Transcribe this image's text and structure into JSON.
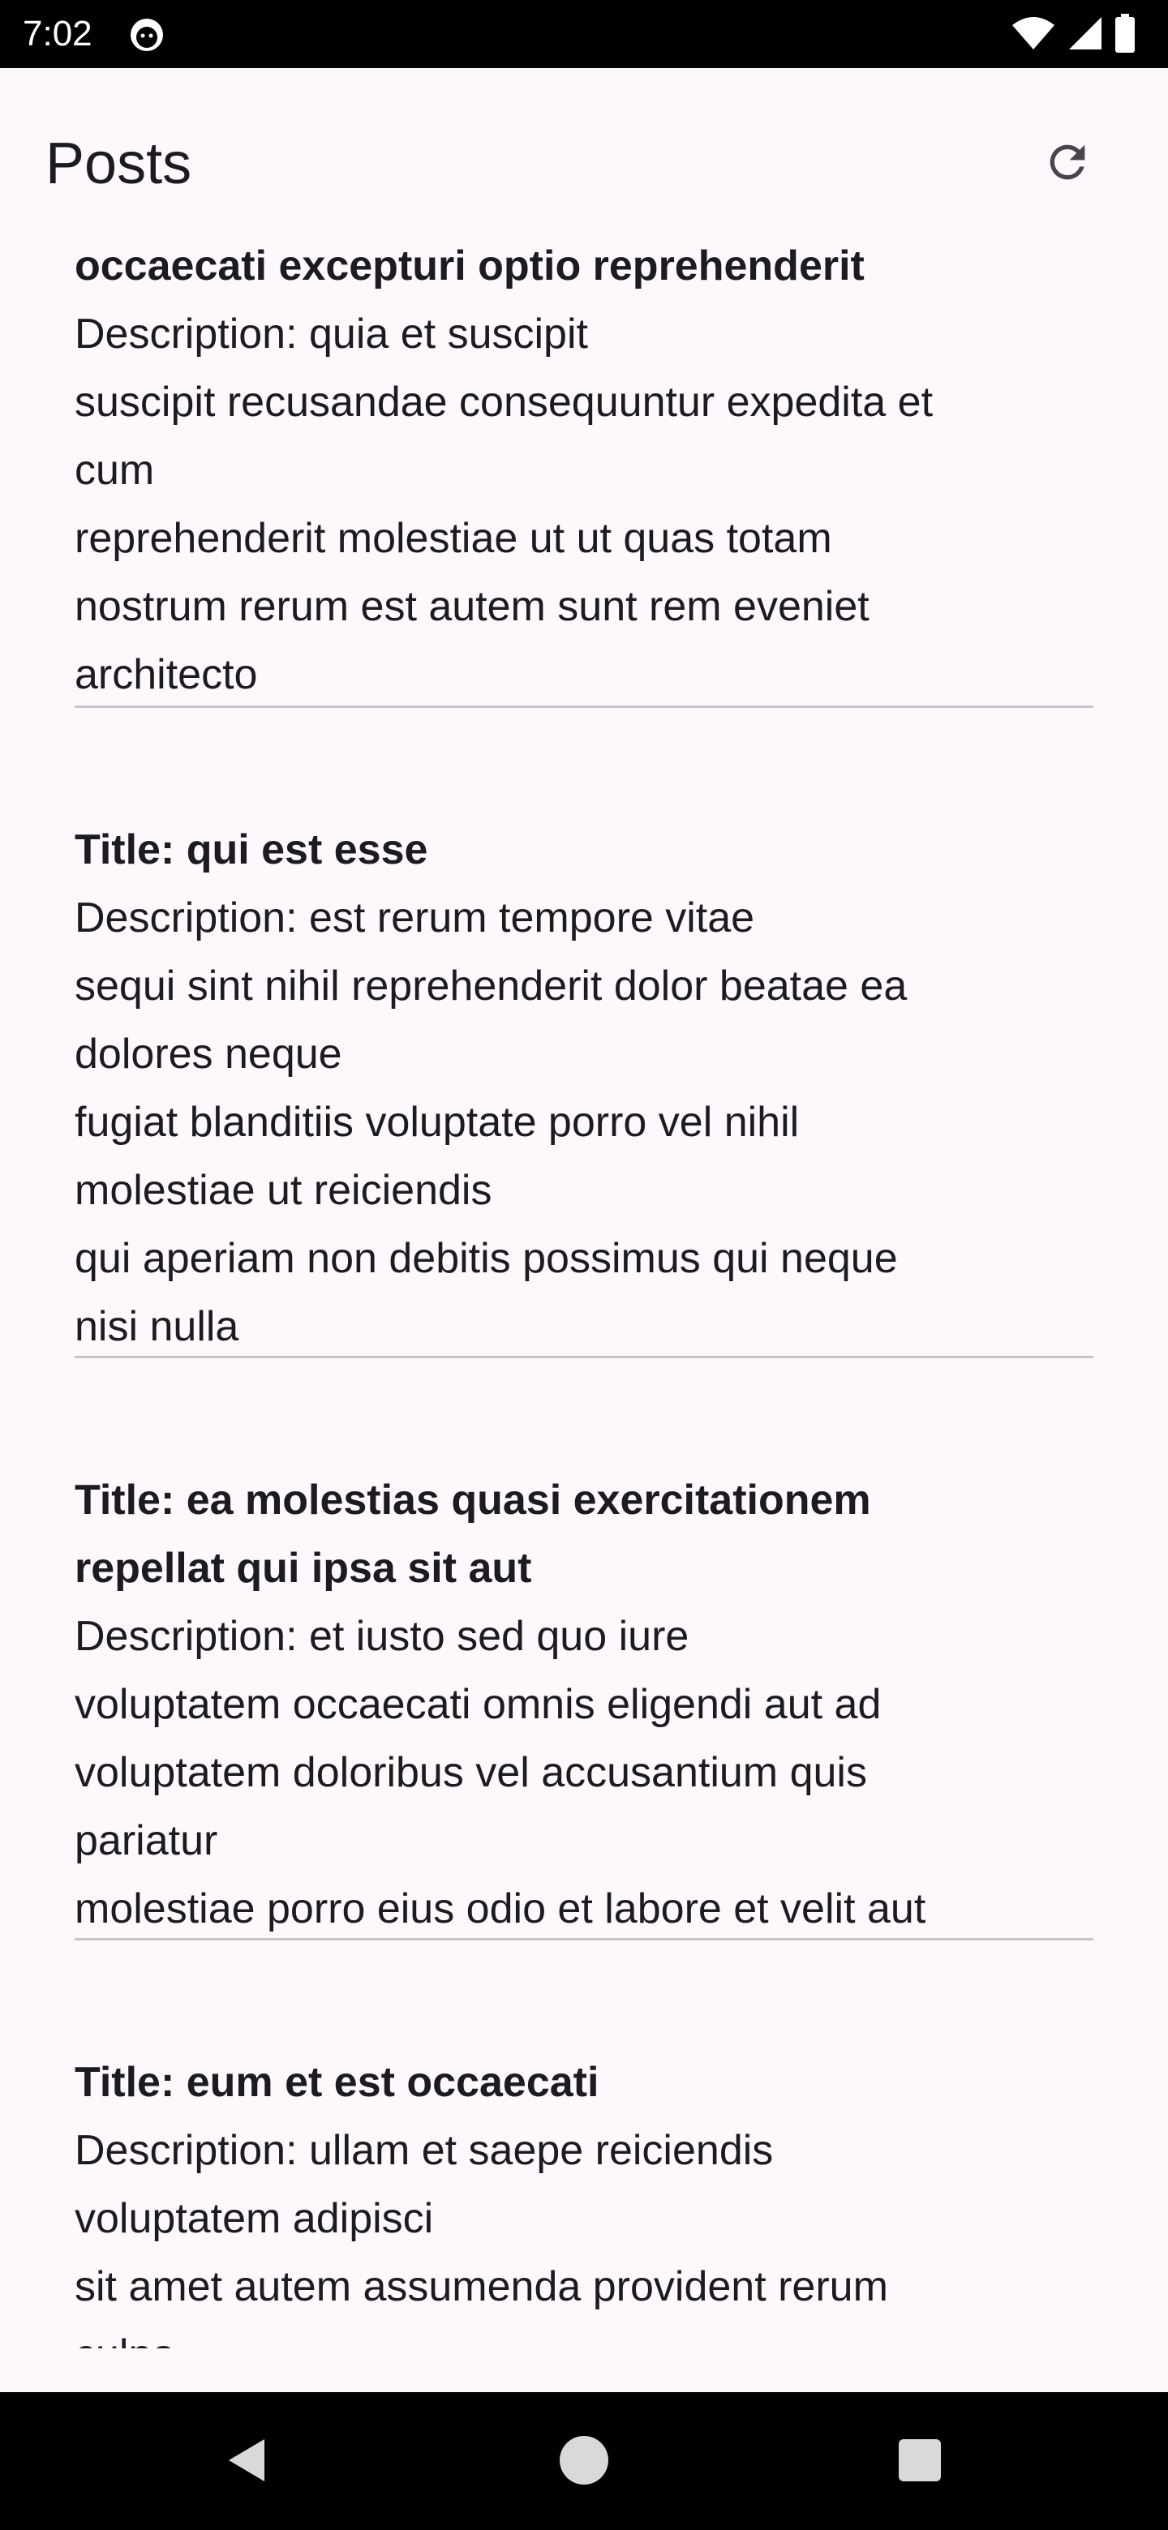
{
  "status_bar": {
    "time": "7:02"
  },
  "app_bar": {
    "title": "Posts",
    "refresh_icon": "refresh-icon"
  },
  "posts": [
    {
      "title": "occaecati excepturi optio reprehenderit",
      "body": "Description: quia et suscipit\nsuscipit recusandae consequuntur expedita et\ncum\nreprehenderit molestiae ut ut quas totam\nnostrum rerum est autem sunt rem eveniet\narchitecto"
    },
    {
      "title": "Title: qui est esse",
      "body": "Description: est rerum tempore vitae\nsequi sint nihil reprehenderit dolor beatae ea\ndolores neque\nfugiat blanditiis voluptate porro vel nihil\nmolestiae ut reiciendis\nqui aperiam non debitis possimus qui neque\nnisi nulla"
    },
    {
      "title": "Title: ea molestias quasi exercitationem\nrepellat qui ipsa sit aut",
      "body": "Description: et iusto sed quo iure\nvoluptatem occaecati omnis eligendi aut ad\nvoluptatem doloribus vel accusantium quis\npariatur\nmolestiae porro eius odio et labore et velit aut"
    },
    {
      "title": "Title: eum et est occaecati",
      "body": "Description: ullam et saepe reiciendis\nvoluptatem adipisci\nsit amet autem assumenda provident rerum\nculpa"
    }
  ],
  "nav_bar": {
    "back_icon": "back-triangle-icon",
    "home_icon": "home-circle-icon",
    "recents_icon": "recents-square-icon"
  },
  "colors": {
    "background": "#fdf8fc",
    "text": "#1c1b1f",
    "divider": "#c8c5ca",
    "system_bars": "#000000"
  }
}
